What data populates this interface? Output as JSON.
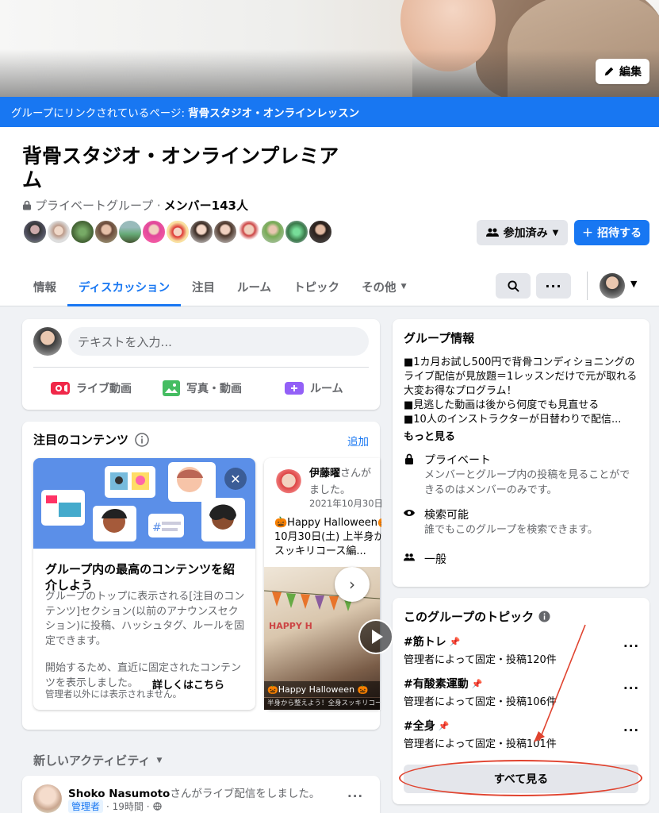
{
  "cover": {
    "edit_label": "編集"
  },
  "linked_page": {
    "prefix": "グループにリンクされているページ:",
    "name": "背骨スタジオ・オンラインレッスン"
  },
  "group": {
    "title": "背骨スタジオ・オンラインプレミアム",
    "privacy": "プライベートグループ ·",
    "members": "メンバー143人",
    "member_avatar_count": 13
  },
  "actions": {
    "joined_label": "参加済み",
    "invite_label": "招待する"
  },
  "tabs": [
    {
      "label": "情報"
    },
    {
      "label": "ディスカッション",
      "active": true
    },
    {
      "label": "注目"
    },
    {
      "label": "ルーム"
    },
    {
      "label": "トピック"
    },
    {
      "label": "その他"
    }
  ],
  "composer": {
    "placeholder": "テキストを入力...",
    "actions": [
      {
        "label": "ライブ動画",
        "icon": "live-video-icon",
        "color": "#f02849"
      },
      {
        "label": "写真・動画",
        "icon": "photo-icon",
        "color": "#45bd62"
      },
      {
        "label": "ルーム",
        "icon": "room-icon",
        "color": "#9360f7"
      }
    ]
  },
  "featured": {
    "title": "注目のコンテンツ",
    "add_label": "追加",
    "promo": {
      "heading": "グループ内の最高のコンテンツを紹介しよう",
      "body": "グループのトップに表示される[注目のコンテンツ]セクション(以前のアナウンスセクション)に投稿、ハッシュタグ、ルールを固定できます。",
      "body2": "開始するため、直近に固定されたコンテンツを表示しました。",
      "link": "詳しくはこちら",
      "note": "管理者以外には表示されません。"
    },
    "post": {
      "author": "伊藤曜",
      "action": "さんが",
      "action2": "ました。",
      "date": "2021年10月30日",
      "text1": "🎃Happy Halloween🎃",
      "text2": "10月30日(土) 上半身か",
      "text3": "スッキリコース編...",
      "caption": "🎃Happy Halloween 🎃",
      "caption2": "半身から整えよう！全身スッキリコース編"
    }
  },
  "new_activity": {
    "label": "新しいアクティビティ"
  },
  "feed": {
    "author": "Shoko Nasumoto",
    "action": "さんがライブ配信をしました。",
    "badge": "管理者",
    "time": "· 19時間 ·"
  },
  "about": {
    "title": "グループ情報",
    "desc": [
      "■1カ月お試し500円で背骨コンディショニングのライブ配信が見放題＝1レッスンだけで元が取れる大変お得なプログラム！",
      "■見逃した動画は後から何度でも見直せる",
      "■10人のインストラクターが日替わりで配信..."
    ],
    "more": "もっと見る",
    "rows": [
      {
        "icon": "lock-icon",
        "title": "プライベート",
        "desc": "メンバーとグループ内の投稿を見ることができるのはメンバーのみです。"
      },
      {
        "icon": "eye-icon",
        "title": "検索可能",
        "desc": "誰でもこのグループを検索できます。"
      },
      {
        "icon": "people-icon",
        "title": "一般",
        "desc": ""
      }
    ]
  },
  "topics": {
    "title": "このグループのトピック",
    "items": [
      {
        "name": "#筋トレ",
        "meta": "管理者によって固定・投稿120件"
      },
      {
        "name": "#有酸素運動",
        "meta": "管理者によって固定・投稿106件"
      },
      {
        "name": "#全身",
        "meta": "管理者によって固定・投稿101件"
      }
    ],
    "see_all": "すべて見る"
  },
  "colors": {
    "accent": "#1877f2",
    "annotation": "#e0432f"
  }
}
